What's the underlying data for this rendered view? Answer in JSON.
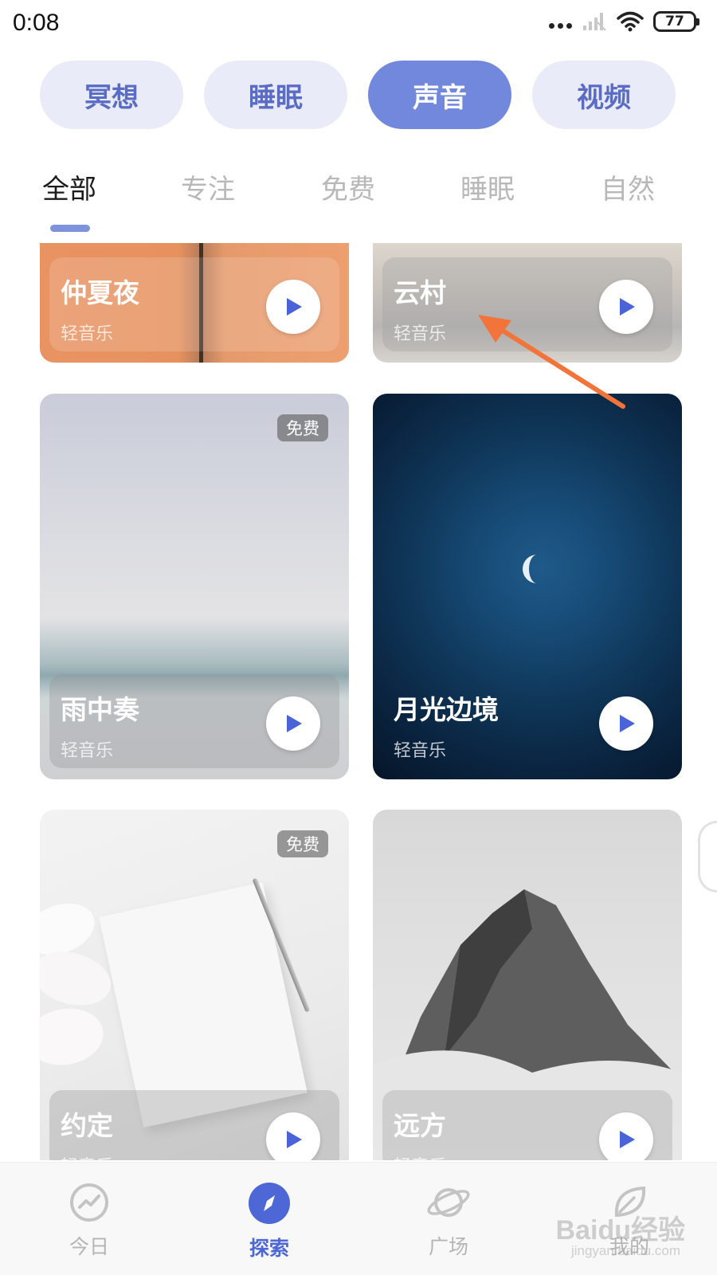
{
  "status_bar": {
    "time": "0:08",
    "battery": "77"
  },
  "top_tabs": [
    {
      "label": "冥想"
    },
    {
      "label": "睡眠"
    },
    {
      "label": "声音"
    },
    {
      "label": "视频"
    }
  ],
  "sub_tabs": [
    {
      "label": "全部"
    },
    {
      "label": "专注"
    },
    {
      "label": "免费"
    },
    {
      "label": "睡眠"
    },
    {
      "label": "自然"
    }
  ],
  "cards": [
    {
      "title": "仲夏夜",
      "subtitle": "轻音乐"
    },
    {
      "title": "云村",
      "subtitle": "轻音乐"
    },
    {
      "title": "雨中奏",
      "subtitle": "轻音乐",
      "badge": "免费"
    },
    {
      "title": "月光边境",
      "subtitle": "轻音乐"
    },
    {
      "title": "约定",
      "subtitle": "轻音乐",
      "badge": "免费"
    },
    {
      "title": "远方",
      "subtitle": "轻音乐"
    }
  ],
  "bottom_nav": [
    {
      "label": "今日",
      "icon": "chart-icon"
    },
    {
      "label": "探索",
      "icon": "compass-icon"
    },
    {
      "label": "广场",
      "icon": "planet-icon"
    },
    {
      "label": "我的",
      "icon": "leaf-icon"
    }
  ],
  "watermark": {
    "text": "Baidu经验",
    "sub": "jingyan.baidu.com"
  },
  "colors": {
    "accent": "#7288dc",
    "accent_dark": "#4d67d6",
    "pill_bg": "#e9ecf8",
    "annotation_arrow": "#f2743a"
  }
}
